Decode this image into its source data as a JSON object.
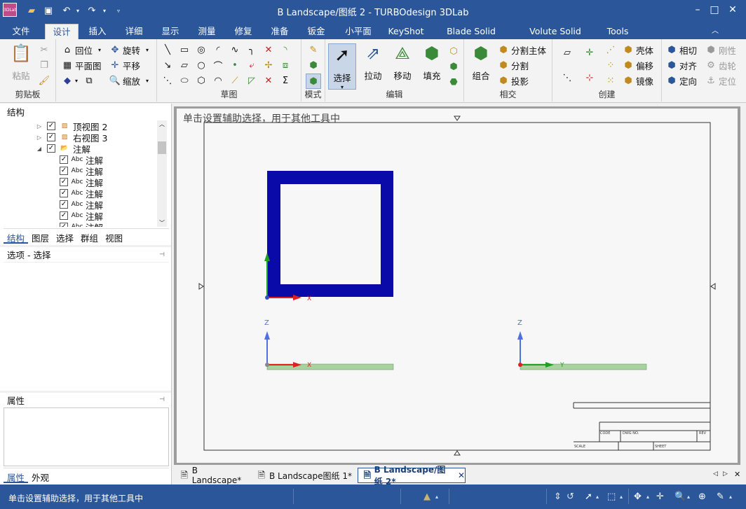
{
  "window": {
    "title": "B Landscape/图纸 2 - TURBOdesign 3DLab",
    "app_logo_text": "3DLab"
  },
  "ribbon_tabs": [
    "文件",
    "设计",
    "插入",
    "详细",
    "显示",
    "测量",
    "修复",
    "准备",
    "钣金",
    "小平面",
    "KeyShot",
    "Blade Solid Model",
    "Volute Solid Model",
    "Tools"
  ],
  "ribbon": {
    "clipboard": {
      "paste": "粘贴",
      "group": "剪贴板"
    },
    "orient": {
      "home": "回位",
      "rotate": "旋转",
      "plan": "平面图",
      "pan": "平移",
      "zoom": "缩放"
    },
    "sketch": {
      "group": "草图"
    },
    "mode": {
      "group": "模式"
    },
    "edit": {
      "select": "选择",
      "pull": "拉动",
      "move": "移动",
      "fill": "填充",
      "group": "编辑"
    },
    "intersect": {
      "combine": "组合",
      "split_body": "分割主体",
      "split": "分割",
      "project": "投影",
      "group": "相交"
    },
    "create": {
      "shell": "壳体",
      "offset": "偏移",
      "mirror": "镜像",
      "intersect": "相切",
      "align": "对齐",
      "orient": "定向",
      "rigid": "刚性",
      "gear": "齿轮",
      "position": "定位",
      "group": "创建"
    }
  },
  "structure_panel": {
    "title": "结构",
    "items": [
      {
        "label": "顶视图 2",
        "checked": true,
        "type": "view"
      },
      {
        "label": "右视图 3",
        "checked": true,
        "type": "view"
      },
      {
        "label": "注解",
        "checked": true,
        "type": "folder"
      },
      {
        "label": "注解",
        "checked": true,
        "type": "note"
      },
      {
        "label": "注解",
        "checked": true,
        "type": "note"
      },
      {
        "label": "注解",
        "checked": true,
        "type": "note"
      },
      {
        "label": "注解",
        "checked": true,
        "type": "note"
      },
      {
        "label": "注解",
        "checked": true,
        "type": "note"
      },
      {
        "label": "注解",
        "checked": true,
        "type": "note"
      },
      {
        "label": "注解",
        "checked": true,
        "type": "note"
      }
    ],
    "tabs": [
      "结构",
      "图层",
      "选择",
      "群组",
      "视图"
    ]
  },
  "options_panel": {
    "title": "选项 - 选择"
  },
  "properties_panel": {
    "title": "属性",
    "tabs": [
      "属性",
      "外观"
    ]
  },
  "canvas": {
    "hint": "单击设置辅助选择，用于其他工具中",
    "axis_labels": {
      "z": "Z",
      "x": "X",
      "y": "Y"
    },
    "title_block": {
      "code": "CODE",
      "dwg_no": "DWG NO.",
      "rev": "REV",
      "scale": "SCALE",
      "sheet": "SHEET"
    },
    "colors": {
      "frame_blue": "#0a0aa8",
      "flat_green": "#a8d3a0",
      "axis_red": "#e02020",
      "axis_green": "#20a020",
      "axis_blue": "#5070e0"
    }
  },
  "doc_tabs": [
    {
      "label": "B Landscape*",
      "active": false
    },
    {
      "label": "B Landscape图纸 1*",
      "active": false
    },
    {
      "label": "B Landscape/图纸 2*",
      "active": true
    }
  ],
  "status": {
    "text": "单击设置辅助选择，用于其他工具中"
  }
}
